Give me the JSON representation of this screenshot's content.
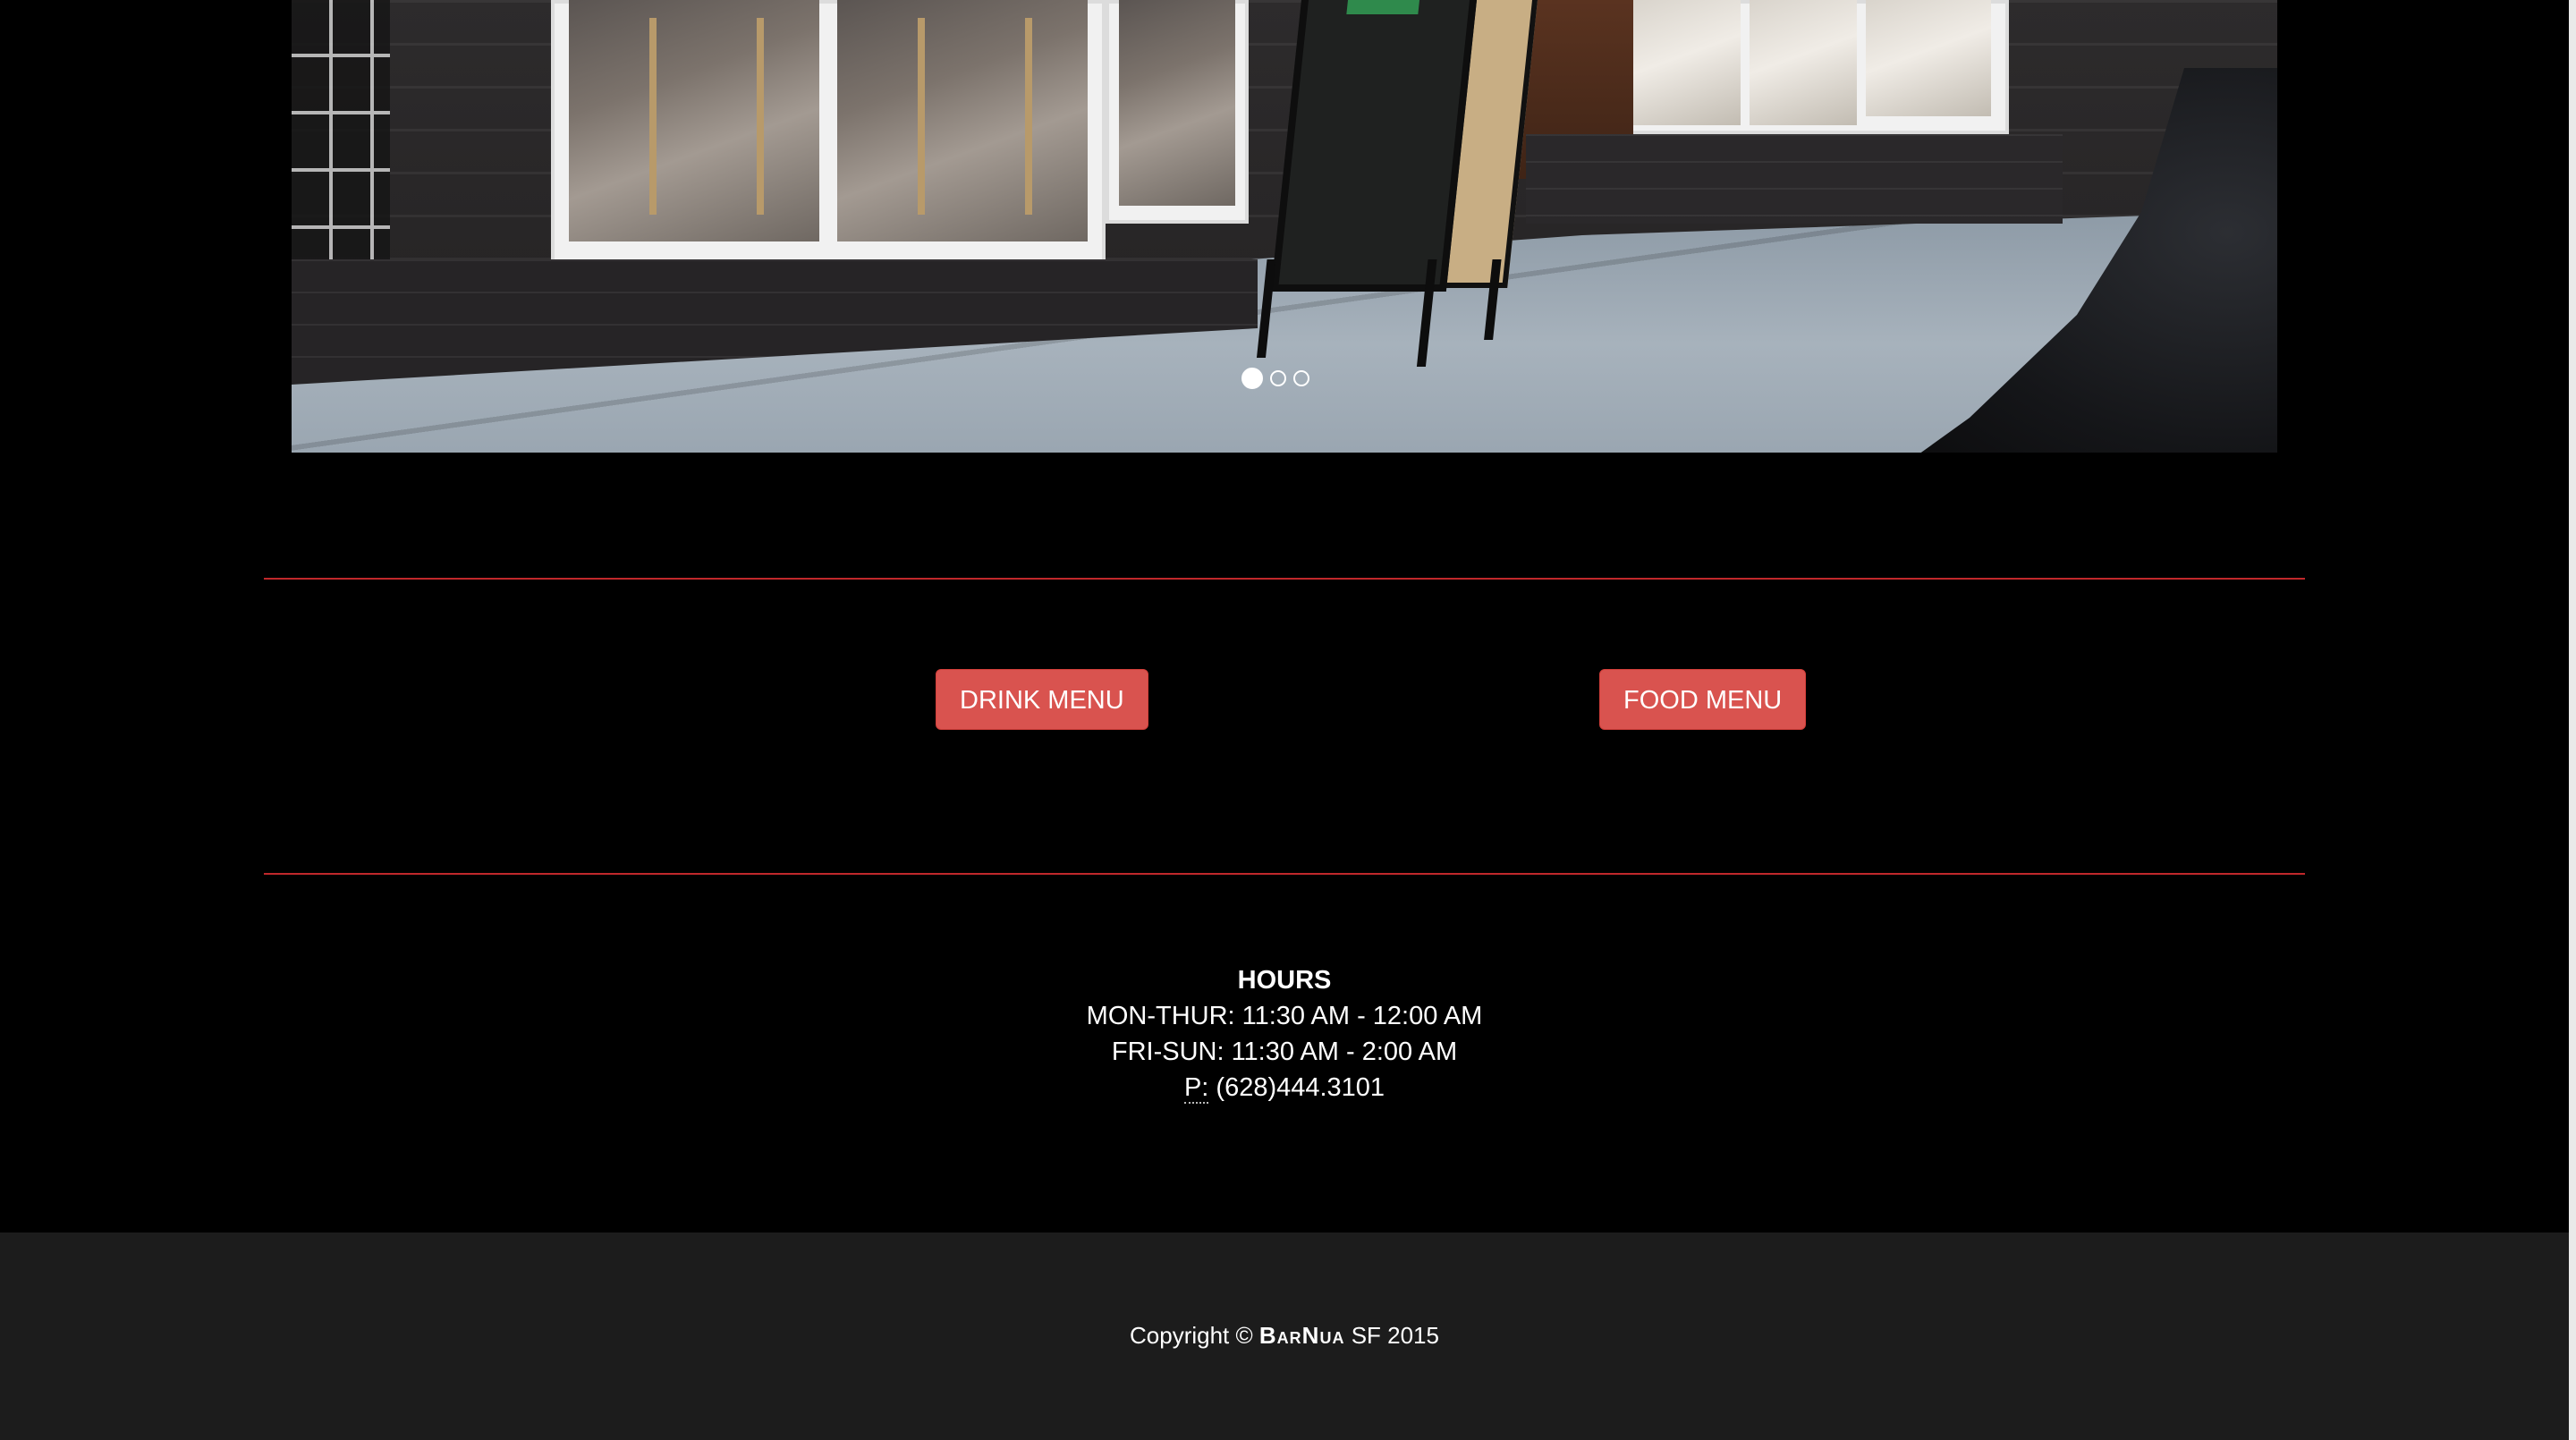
{
  "carousel": {
    "slides": 3,
    "active_slide": 1
  },
  "menus": {
    "drink_label": "DRINK MENU",
    "food_label": "FOOD MENU"
  },
  "hours": {
    "title": "HOURS",
    "weekday": "MON-THUR: 11:30 AM - 12:00 AM",
    "weekend": "FRI-SUN: 11:30 AM - 2:00 AM",
    "phone_label": "P:",
    "phone_number": "(628)444.3101"
  },
  "footer": {
    "copyright_prefix": "Copyright ©",
    "brand": "BarNua",
    "copyright_suffix": "SF 2015"
  },
  "colors": {
    "accent": "#d9534f",
    "rule": "#c0282b",
    "footer_bg": "#1c1c1c",
    "page_bg": "#000000"
  }
}
